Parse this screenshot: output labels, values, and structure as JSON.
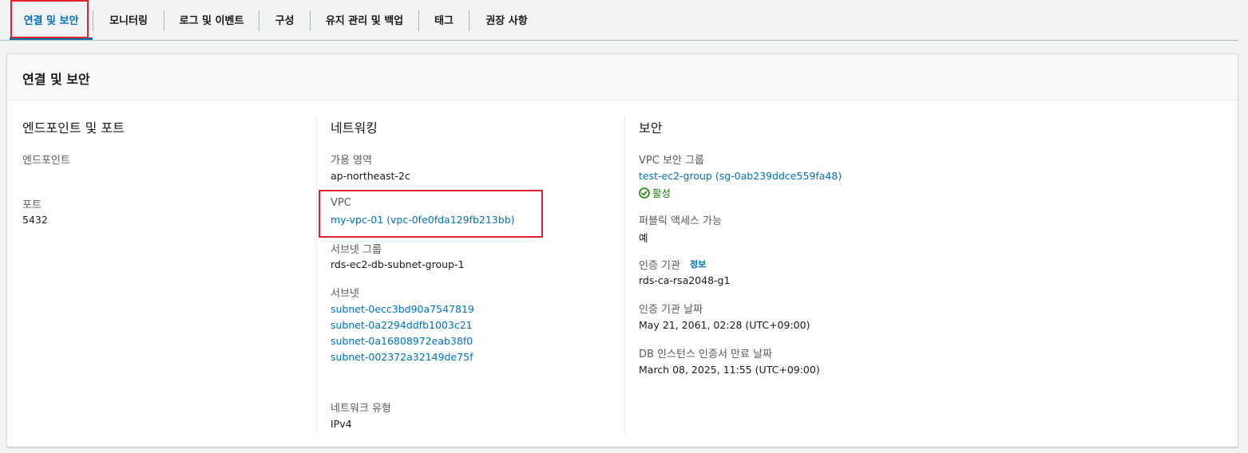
{
  "tabs": [
    {
      "label": "연결 및 보안",
      "active": true
    },
    {
      "label": "모니터링"
    },
    {
      "label": "로그 및 이벤트"
    },
    {
      "label": "구성"
    },
    {
      "label": "유지 관리 및 백업"
    },
    {
      "label": "태그"
    },
    {
      "label": "권장 사항"
    }
  ],
  "panel": {
    "title": "연결 및 보안"
  },
  "endpoint_section": {
    "title": "엔드포인트 및 포트",
    "endpoint_label": "엔드포인트",
    "port_label": "포트",
    "port_value": "5432"
  },
  "network_section": {
    "title": "네트워킹",
    "az_label": "가용 영역",
    "az_value": "ap-northeast-2c",
    "vpc_label": "VPC",
    "vpc_value": "my-vpc-01 (vpc-0fe0fda129fb213bb)",
    "subnet_group_label": "서브넷 그룹",
    "subnet_group_value": "rds-ec2-db-subnet-group-1",
    "subnets_label": "서브넷",
    "subnets": [
      "subnet-0ecc3bd90a7547819",
      "subnet-0a2294ddfb1003c21",
      "subnet-0a16808972eab38f0",
      "subnet-002372a32149de75f"
    ],
    "network_type_label": "네트워크 유형",
    "network_type_value": "IPv4"
  },
  "security_section": {
    "title": "보안",
    "sg_label": "VPC 보안 그룹",
    "sg_value": "test-ec2-group (sg-0ab239ddce559fa48)",
    "sg_status": "활성",
    "public_access_label": "퍼블릭 액세스 가능",
    "public_access_value": "예",
    "ca_label": "인증 기관",
    "ca_info": "정보",
    "ca_value": "rds-ca-rsa2048-g1",
    "ca_date_label": "인증 기관 날짜",
    "ca_date_value": "May 21, 2061, 02:28 (UTC+09:00)",
    "cert_expiry_label": "DB 인스턴스 인증서 만료 날짜",
    "cert_expiry_value": "March 08, 2025, 11:55 (UTC+09:00)"
  },
  "colors": {
    "link": "#0073bb",
    "success": "#1d8102",
    "highlight": "#e0232f"
  },
  "icons": {
    "status": "check-circle-icon"
  }
}
